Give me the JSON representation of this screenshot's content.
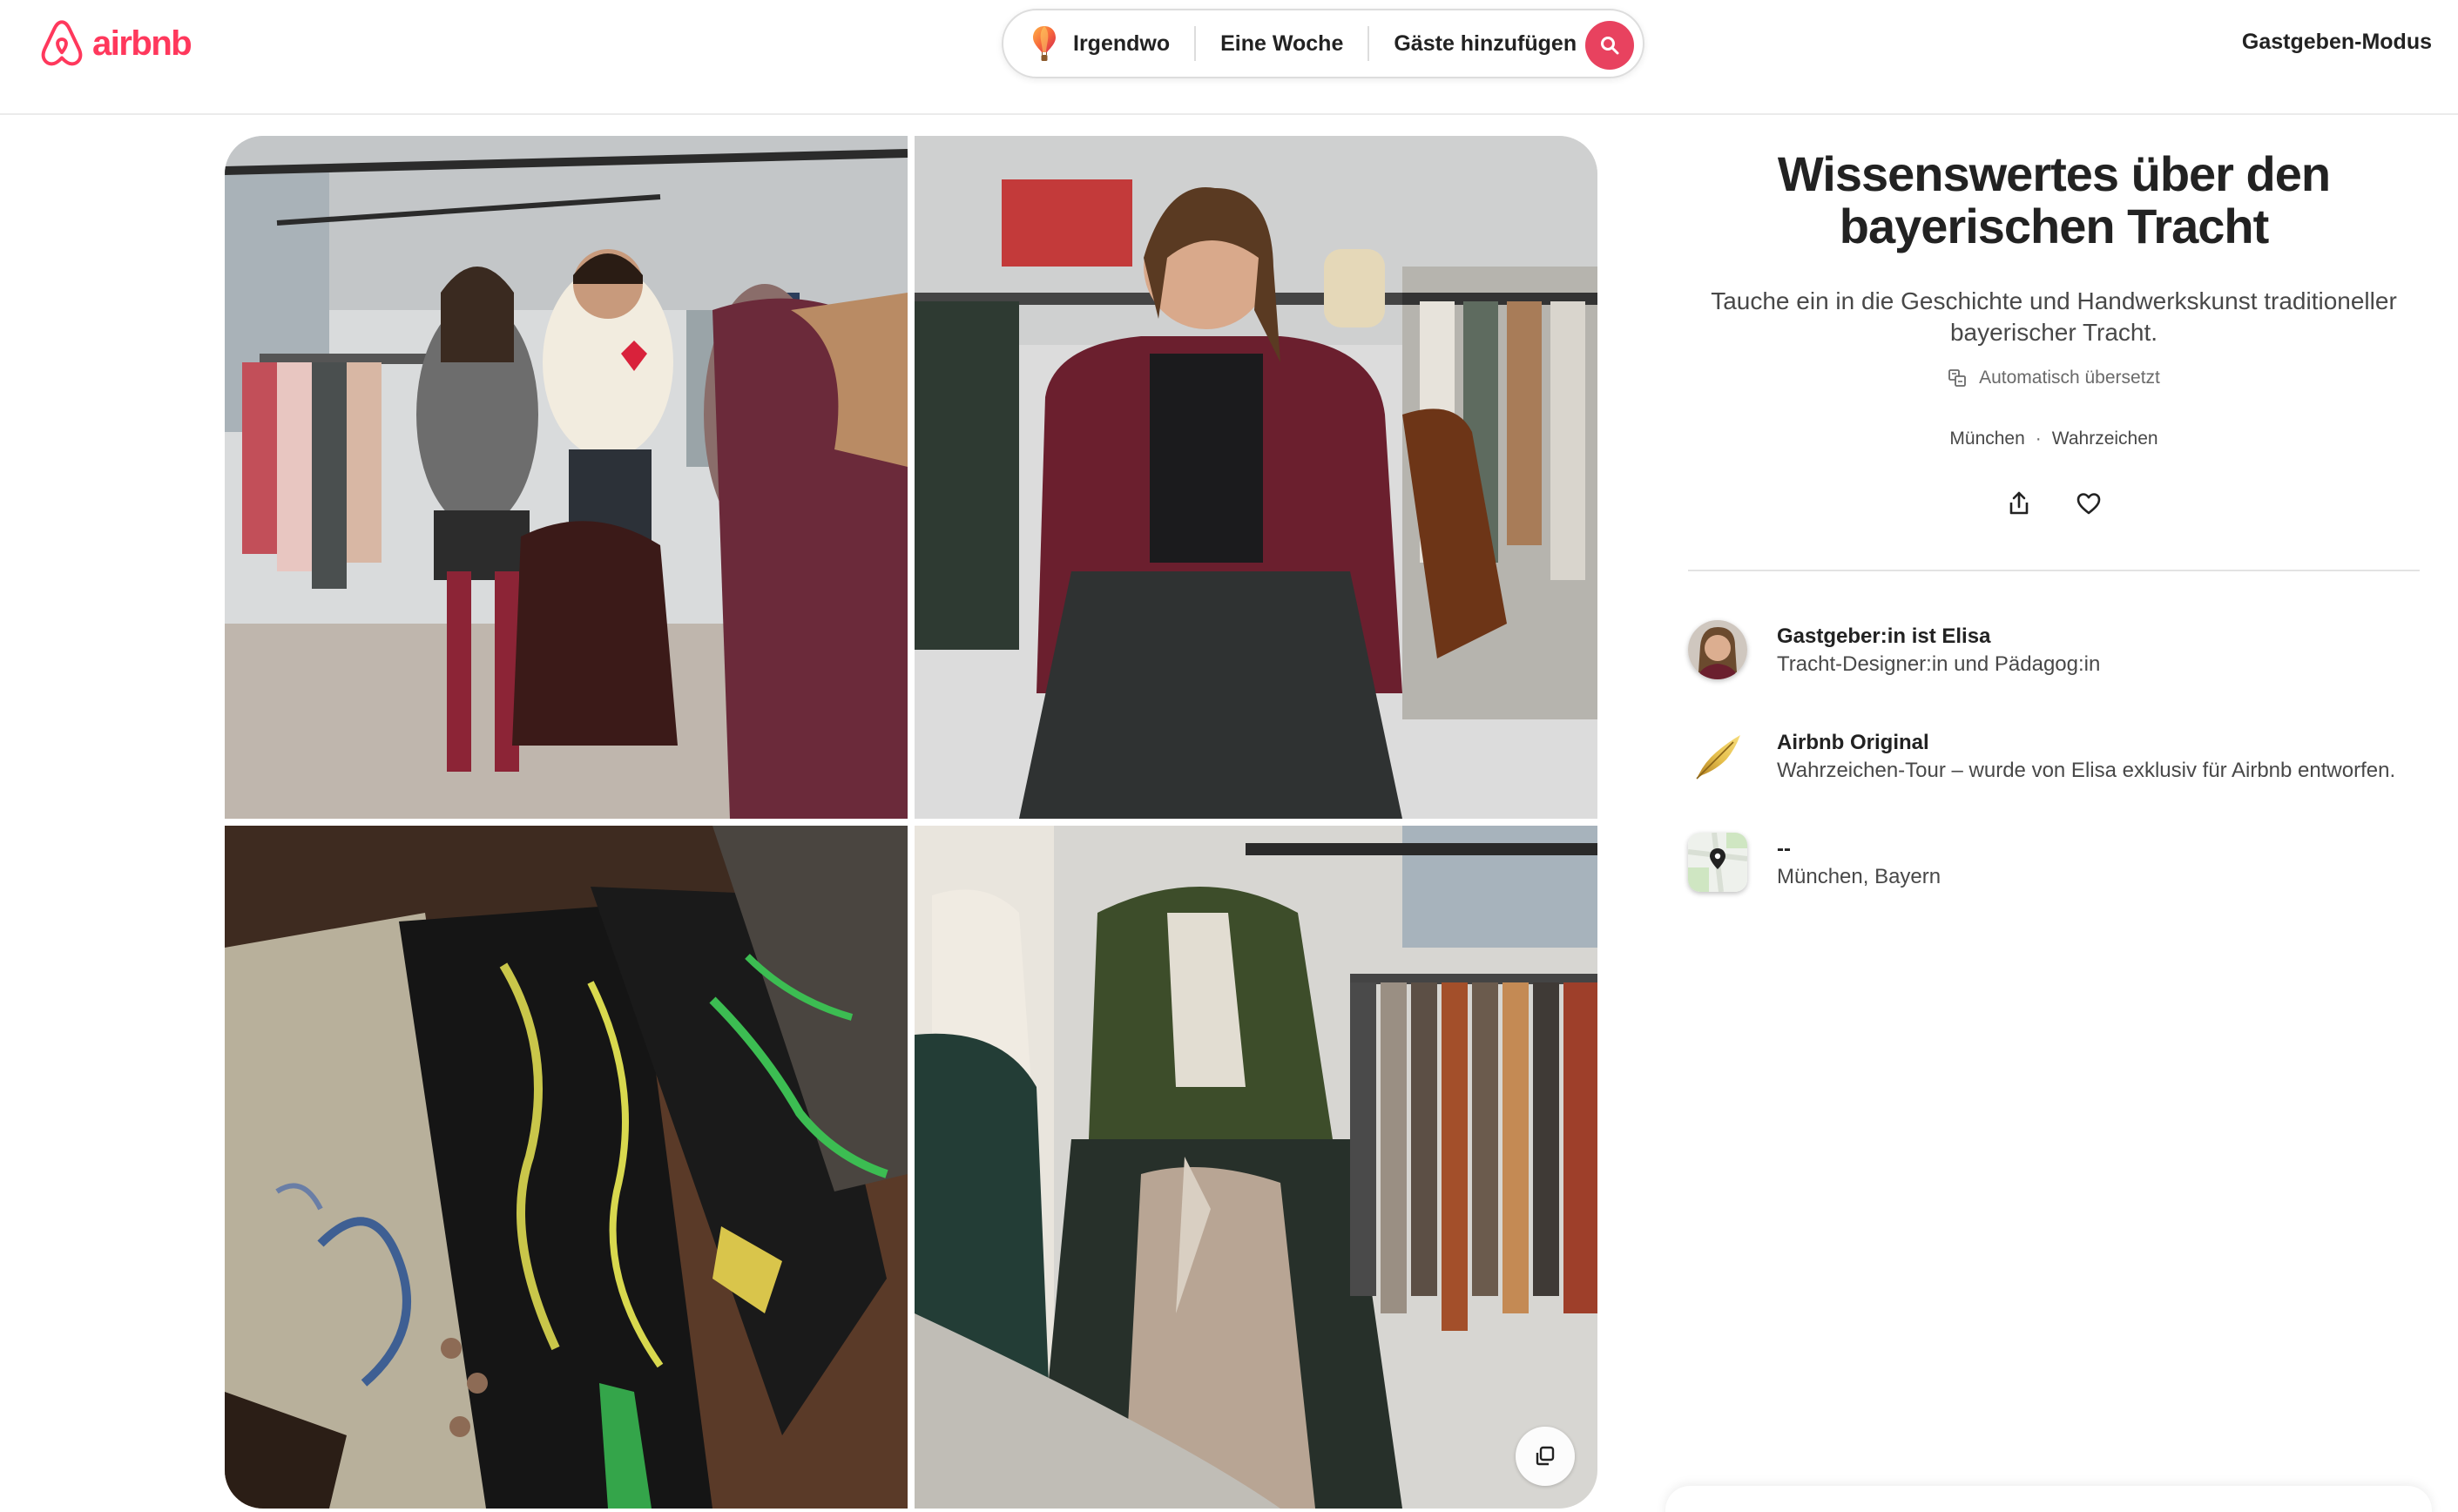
{
  "header": {
    "logo_text": "airbnb",
    "search": {
      "where": "Irgendwo",
      "when": "Eine Woche",
      "guests": "Gäste hinzufügen"
    },
    "host_mode": "Gastgeben-Modus"
  },
  "listing": {
    "title": "Wissenswertes über den bayerischen Tracht",
    "subtitle": "Tauche ein in die Geschichte und Handwerkskunst traditioneller bayerischer Tracht.",
    "auto_translated": "Automatisch übersetzt",
    "location": "München",
    "separator": "·",
    "category": "Wahrzeichen"
  },
  "host": {
    "title": "Gastgeber:in ist Elisa",
    "role": "Tracht-Designer:in und Pädagog:in"
  },
  "original": {
    "title": "Airbnb Original",
    "description": "Wahrzeichen-Tour – wurde von Elisa exklusiv für Airbnb entworfen."
  },
  "place": {
    "title": "--",
    "address": "München, Bayern"
  },
  "icons": {
    "logo": "airbnb-logo-icon",
    "balloon": "balloon-icon",
    "search": "search-icon",
    "translate": "translate-icon",
    "share": "share-icon",
    "heart": "heart-icon",
    "feather": "feather-icon",
    "map": "map-pin-icon",
    "gallery": "show-all-photos-icon"
  },
  "colors": {
    "brand": "#ff385c",
    "search_button": "#e8425f",
    "text_primary": "#222222",
    "text_secondary": "#484848"
  }
}
